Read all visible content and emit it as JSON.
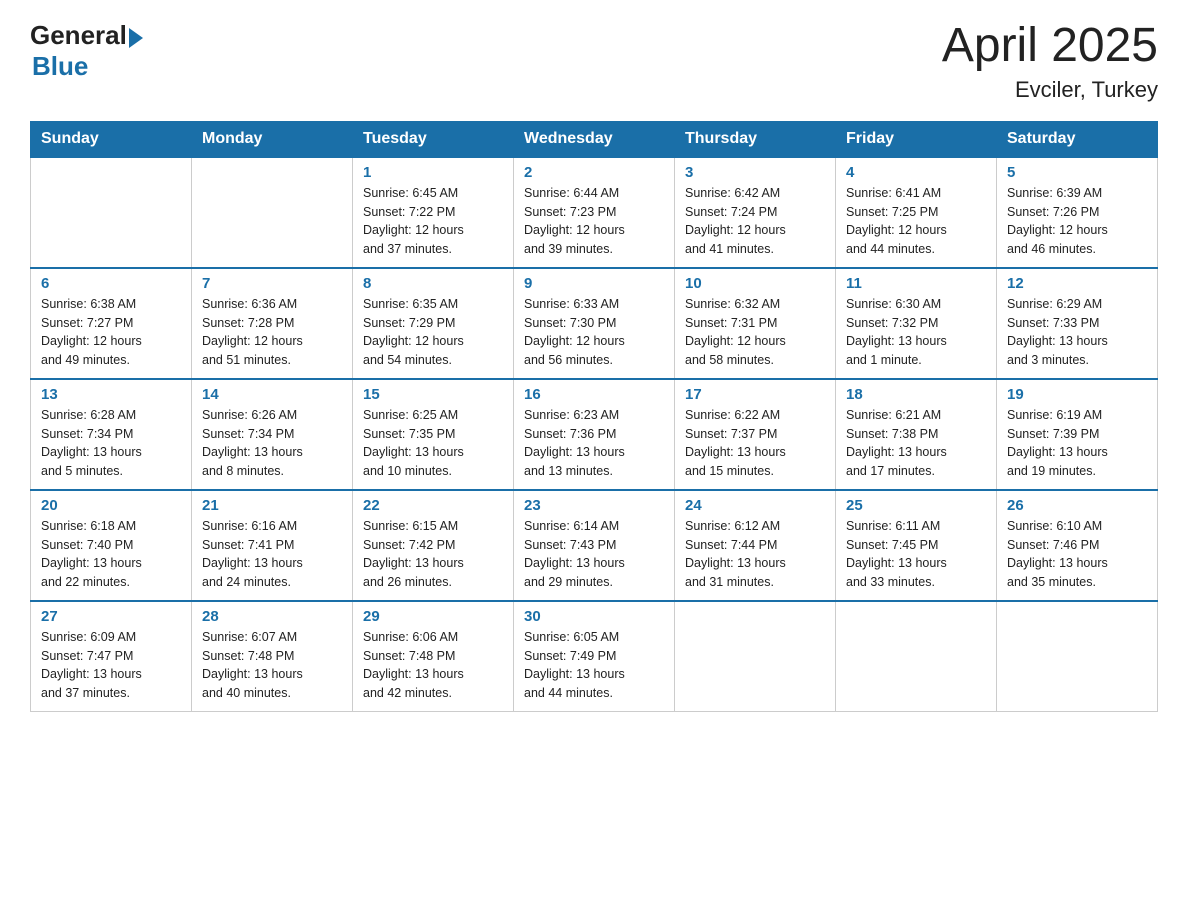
{
  "header": {
    "logo_general": "General",
    "logo_blue": "Blue",
    "month_title": "April 2025",
    "location": "Evciler, Turkey"
  },
  "days_of_week": [
    "Sunday",
    "Monday",
    "Tuesday",
    "Wednesday",
    "Thursday",
    "Friday",
    "Saturday"
  ],
  "weeks": [
    [
      {
        "day": "",
        "info": ""
      },
      {
        "day": "",
        "info": ""
      },
      {
        "day": "1",
        "info": "Sunrise: 6:45 AM\nSunset: 7:22 PM\nDaylight: 12 hours\nand 37 minutes."
      },
      {
        "day": "2",
        "info": "Sunrise: 6:44 AM\nSunset: 7:23 PM\nDaylight: 12 hours\nand 39 minutes."
      },
      {
        "day": "3",
        "info": "Sunrise: 6:42 AM\nSunset: 7:24 PM\nDaylight: 12 hours\nand 41 minutes."
      },
      {
        "day": "4",
        "info": "Sunrise: 6:41 AM\nSunset: 7:25 PM\nDaylight: 12 hours\nand 44 minutes."
      },
      {
        "day": "5",
        "info": "Sunrise: 6:39 AM\nSunset: 7:26 PM\nDaylight: 12 hours\nand 46 minutes."
      }
    ],
    [
      {
        "day": "6",
        "info": "Sunrise: 6:38 AM\nSunset: 7:27 PM\nDaylight: 12 hours\nand 49 minutes."
      },
      {
        "day": "7",
        "info": "Sunrise: 6:36 AM\nSunset: 7:28 PM\nDaylight: 12 hours\nand 51 minutes."
      },
      {
        "day": "8",
        "info": "Sunrise: 6:35 AM\nSunset: 7:29 PM\nDaylight: 12 hours\nand 54 minutes."
      },
      {
        "day": "9",
        "info": "Sunrise: 6:33 AM\nSunset: 7:30 PM\nDaylight: 12 hours\nand 56 minutes."
      },
      {
        "day": "10",
        "info": "Sunrise: 6:32 AM\nSunset: 7:31 PM\nDaylight: 12 hours\nand 58 minutes."
      },
      {
        "day": "11",
        "info": "Sunrise: 6:30 AM\nSunset: 7:32 PM\nDaylight: 13 hours\nand 1 minute."
      },
      {
        "day": "12",
        "info": "Sunrise: 6:29 AM\nSunset: 7:33 PM\nDaylight: 13 hours\nand 3 minutes."
      }
    ],
    [
      {
        "day": "13",
        "info": "Sunrise: 6:28 AM\nSunset: 7:34 PM\nDaylight: 13 hours\nand 5 minutes."
      },
      {
        "day": "14",
        "info": "Sunrise: 6:26 AM\nSunset: 7:34 PM\nDaylight: 13 hours\nand 8 minutes."
      },
      {
        "day": "15",
        "info": "Sunrise: 6:25 AM\nSunset: 7:35 PM\nDaylight: 13 hours\nand 10 minutes."
      },
      {
        "day": "16",
        "info": "Sunrise: 6:23 AM\nSunset: 7:36 PM\nDaylight: 13 hours\nand 13 minutes."
      },
      {
        "day": "17",
        "info": "Sunrise: 6:22 AM\nSunset: 7:37 PM\nDaylight: 13 hours\nand 15 minutes."
      },
      {
        "day": "18",
        "info": "Sunrise: 6:21 AM\nSunset: 7:38 PM\nDaylight: 13 hours\nand 17 minutes."
      },
      {
        "day": "19",
        "info": "Sunrise: 6:19 AM\nSunset: 7:39 PM\nDaylight: 13 hours\nand 19 minutes."
      }
    ],
    [
      {
        "day": "20",
        "info": "Sunrise: 6:18 AM\nSunset: 7:40 PM\nDaylight: 13 hours\nand 22 minutes."
      },
      {
        "day": "21",
        "info": "Sunrise: 6:16 AM\nSunset: 7:41 PM\nDaylight: 13 hours\nand 24 minutes."
      },
      {
        "day": "22",
        "info": "Sunrise: 6:15 AM\nSunset: 7:42 PM\nDaylight: 13 hours\nand 26 minutes."
      },
      {
        "day": "23",
        "info": "Sunrise: 6:14 AM\nSunset: 7:43 PM\nDaylight: 13 hours\nand 29 minutes."
      },
      {
        "day": "24",
        "info": "Sunrise: 6:12 AM\nSunset: 7:44 PM\nDaylight: 13 hours\nand 31 minutes."
      },
      {
        "day": "25",
        "info": "Sunrise: 6:11 AM\nSunset: 7:45 PM\nDaylight: 13 hours\nand 33 minutes."
      },
      {
        "day": "26",
        "info": "Sunrise: 6:10 AM\nSunset: 7:46 PM\nDaylight: 13 hours\nand 35 minutes."
      }
    ],
    [
      {
        "day": "27",
        "info": "Sunrise: 6:09 AM\nSunset: 7:47 PM\nDaylight: 13 hours\nand 37 minutes."
      },
      {
        "day": "28",
        "info": "Sunrise: 6:07 AM\nSunset: 7:48 PM\nDaylight: 13 hours\nand 40 minutes."
      },
      {
        "day": "29",
        "info": "Sunrise: 6:06 AM\nSunset: 7:48 PM\nDaylight: 13 hours\nand 42 minutes."
      },
      {
        "day": "30",
        "info": "Sunrise: 6:05 AM\nSunset: 7:49 PM\nDaylight: 13 hours\nand 44 minutes."
      },
      {
        "day": "",
        "info": ""
      },
      {
        "day": "",
        "info": ""
      },
      {
        "day": "",
        "info": ""
      }
    ]
  ]
}
